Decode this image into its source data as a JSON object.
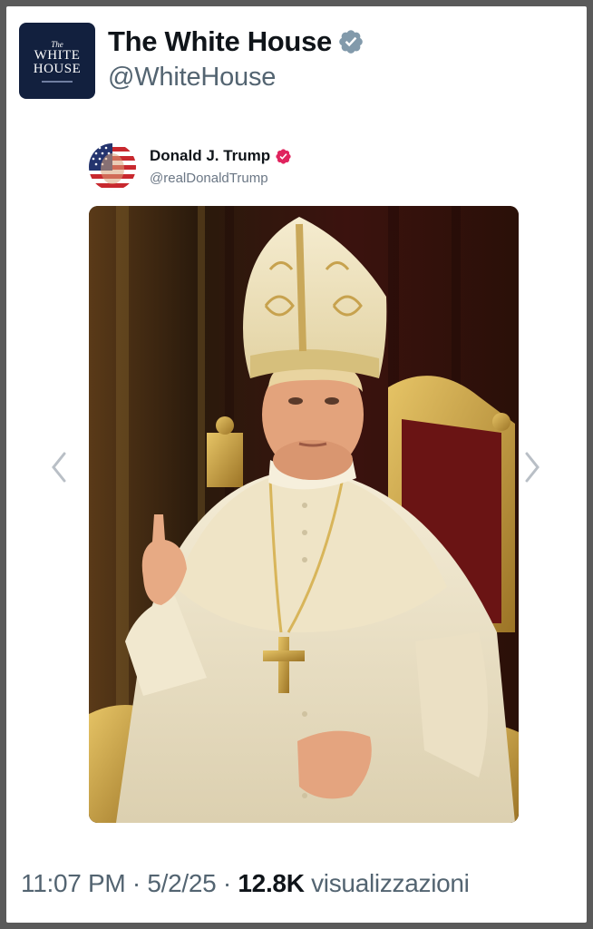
{
  "post": {
    "author": {
      "display_name": "The White House",
      "handle": "@WhiteHouse",
      "verified_color": "#829aab",
      "avatar_logo": {
        "line1": "The",
        "line2": "WHITE",
        "line3": "HOUSE",
        "bg": "#12203e"
      }
    },
    "quoted": {
      "display_name": "Donald J. Trump",
      "handle": "@realDonaldTrump",
      "verified_color": "#e0245e",
      "avatar_icon": "flag-portrait-avatar"
    },
    "media": {
      "subject_icon": "papal-portrait-image",
      "nav_prev_icon": "chevron-left-icon",
      "nav_next_icon": "chevron-right-icon"
    },
    "meta": {
      "time": "11:07 PM",
      "separator": " · ",
      "date": "5/2/25",
      "views_count": "12.8K",
      "views_label": "visualizzazioni"
    }
  }
}
